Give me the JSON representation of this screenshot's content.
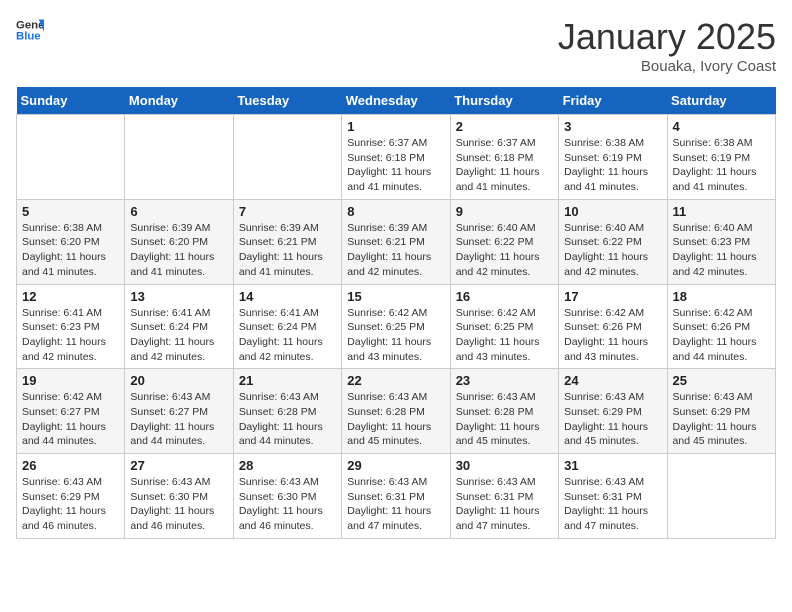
{
  "header": {
    "logo_line1": "General",
    "logo_line2": "Blue",
    "month_title": "January 2025",
    "location": "Bouaka, Ivory Coast"
  },
  "weekdays": [
    "Sunday",
    "Monday",
    "Tuesday",
    "Wednesday",
    "Thursday",
    "Friday",
    "Saturday"
  ],
  "weeks": [
    [
      {
        "day": "",
        "info": ""
      },
      {
        "day": "",
        "info": ""
      },
      {
        "day": "",
        "info": ""
      },
      {
        "day": "1",
        "info": "Sunrise: 6:37 AM\nSunset: 6:18 PM\nDaylight: 11 hours and 41 minutes."
      },
      {
        "day": "2",
        "info": "Sunrise: 6:37 AM\nSunset: 6:18 PM\nDaylight: 11 hours and 41 minutes."
      },
      {
        "day": "3",
        "info": "Sunrise: 6:38 AM\nSunset: 6:19 PM\nDaylight: 11 hours and 41 minutes."
      },
      {
        "day": "4",
        "info": "Sunrise: 6:38 AM\nSunset: 6:19 PM\nDaylight: 11 hours and 41 minutes."
      }
    ],
    [
      {
        "day": "5",
        "info": "Sunrise: 6:38 AM\nSunset: 6:20 PM\nDaylight: 11 hours and 41 minutes."
      },
      {
        "day": "6",
        "info": "Sunrise: 6:39 AM\nSunset: 6:20 PM\nDaylight: 11 hours and 41 minutes."
      },
      {
        "day": "7",
        "info": "Sunrise: 6:39 AM\nSunset: 6:21 PM\nDaylight: 11 hours and 41 minutes."
      },
      {
        "day": "8",
        "info": "Sunrise: 6:39 AM\nSunset: 6:21 PM\nDaylight: 11 hours and 42 minutes."
      },
      {
        "day": "9",
        "info": "Sunrise: 6:40 AM\nSunset: 6:22 PM\nDaylight: 11 hours and 42 minutes."
      },
      {
        "day": "10",
        "info": "Sunrise: 6:40 AM\nSunset: 6:22 PM\nDaylight: 11 hours and 42 minutes."
      },
      {
        "day": "11",
        "info": "Sunrise: 6:40 AM\nSunset: 6:23 PM\nDaylight: 11 hours and 42 minutes."
      }
    ],
    [
      {
        "day": "12",
        "info": "Sunrise: 6:41 AM\nSunset: 6:23 PM\nDaylight: 11 hours and 42 minutes."
      },
      {
        "day": "13",
        "info": "Sunrise: 6:41 AM\nSunset: 6:24 PM\nDaylight: 11 hours and 42 minutes."
      },
      {
        "day": "14",
        "info": "Sunrise: 6:41 AM\nSunset: 6:24 PM\nDaylight: 11 hours and 42 minutes."
      },
      {
        "day": "15",
        "info": "Sunrise: 6:42 AM\nSunset: 6:25 PM\nDaylight: 11 hours and 43 minutes."
      },
      {
        "day": "16",
        "info": "Sunrise: 6:42 AM\nSunset: 6:25 PM\nDaylight: 11 hours and 43 minutes."
      },
      {
        "day": "17",
        "info": "Sunrise: 6:42 AM\nSunset: 6:26 PM\nDaylight: 11 hours and 43 minutes."
      },
      {
        "day": "18",
        "info": "Sunrise: 6:42 AM\nSunset: 6:26 PM\nDaylight: 11 hours and 44 minutes."
      }
    ],
    [
      {
        "day": "19",
        "info": "Sunrise: 6:42 AM\nSunset: 6:27 PM\nDaylight: 11 hours and 44 minutes."
      },
      {
        "day": "20",
        "info": "Sunrise: 6:43 AM\nSunset: 6:27 PM\nDaylight: 11 hours and 44 minutes."
      },
      {
        "day": "21",
        "info": "Sunrise: 6:43 AM\nSunset: 6:28 PM\nDaylight: 11 hours and 44 minutes."
      },
      {
        "day": "22",
        "info": "Sunrise: 6:43 AM\nSunset: 6:28 PM\nDaylight: 11 hours and 45 minutes."
      },
      {
        "day": "23",
        "info": "Sunrise: 6:43 AM\nSunset: 6:28 PM\nDaylight: 11 hours and 45 minutes."
      },
      {
        "day": "24",
        "info": "Sunrise: 6:43 AM\nSunset: 6:29 PM\nDaylight: 11 hours and 45 minutes."
      },
      {
        "day": "25",
        "info": "Sunrise: 6:43 AM\nSunset: 6:29 PM\nDaylight: 11 hours and 45 minutes."
      }
    ],
    [
      {
        "day": "26",
        "info": "Sunrise: 6:43 AM\nSunset: 6:29 PM\nDaylight: 11 hours and 46 minutes."
      },
      {
        "day": "27",
        "info": "Sunrise: 6:43 AM\nSunset: 6:30 PM\nDaylight: 11 hours and 46 minutes."
      },
      {
        "day": "28",
        "info": "Sunrise: 6:43 AM\nSunset: 6:30 PM\nDaylight: 11 hours and 46 minutes."
      },
      {
        "day": "29",
        "info": "Sunrise: 6:43 AM\nSunset: 6:31 PM\nDaylight: 11 hours and 47 minutes."
      },
      {
        "day": "30",
        "info": "Sunrise: 6:43 AM\nSunset: 6:31 PM\nDaylight: 11 hours and 47 minutes."
      },
      {
        "day": "31",
        "info": "Sunrise: 6:43 AM\nSunset: 6:31 PM\nDaylight: 11 hours and 47 minutes."
      },
      {
        "day": "",
        "info": ""
      }
    ]
  ]
}
